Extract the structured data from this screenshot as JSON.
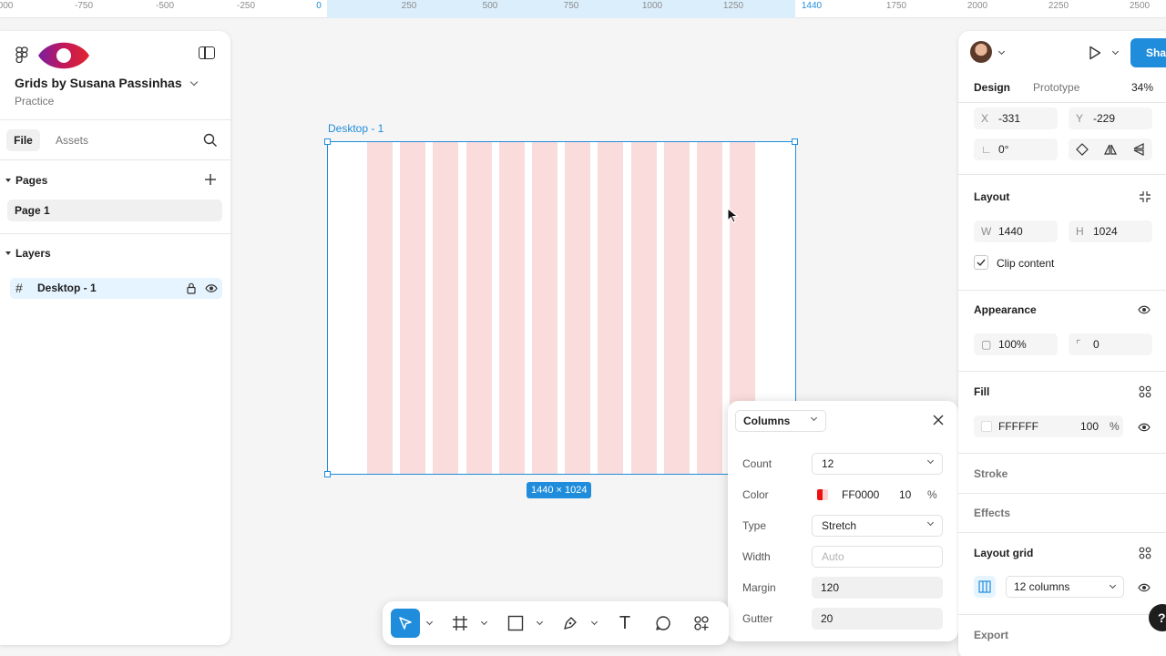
{
  "ruler": {
    "ticks": [
      "000",
      "-750",
      "-500",
      "-250",
      "0",
      "250",
      "500",
      "750",
      "1000",
      "1250",
      "1440",
      "1750",
      "2000",
      "2250",
      "2500"
    ]
  },
  "file": {
    "title": "Grids by Susana Passinhas",
    "project": "Practice",
    "tabs": {
      "file": "File",
      "assets": "Assets"
    }
  },
  "pages": {
    "heading": "Pages",
    "items": [
      "Page 1"
    ]
  },
  "layers": {
    "heading": "Layers",
    "items": [
      {
        "name": "Desktop - 1",
        "icon": "frame-hash-icon"
      }
    ]
  },
  "canvas": {
    "frame_label": "Desktop - 1",
    "size_label": "1440 × 1024",
    "column_count": 12,
    "grid_color": "#fbdcdc",
    "selection_color": "#1f8ddb"
  },
  "grid_popover": {
    "mode": "Columns",
    "count_label": "Count",
    "count": "12",
    "color_label": "Color",
    "color_hex": "FF0000",
    "color_opacity": "10",
    "percent": "%",
    "type_label": "Type",
    "type": "Stretch",
    "width_label": "Width",
    "width_placeholder": "Auto",
    "margin_label": "Margin",
    "margin": "120",
    "gutter_label": "Gutter",
    "gutter": "20"
  },
  "toolbar": {
    "tools": [
      "move-tool",
      "frame-tool",
      "shape-tool",
      "pen-tool",
      "text-tool",
      "comment-tool",
      "actions-tool"
    ],
    "text_glyph": "T"
  },
  "right_panel": {
    "share": "Share",
    "tabs": {
      "design": "Design",
      "prototype": "Prototype"
    },
    "zoom": "34%",
    "position": {
      "x_label": "X",
      "x": "-331",
      "y_label": "Y",
      "y": "-229"
    },
    "rotation": "0°",
    "layout": {
      "heading": "Layout",
      "w_label": "W",
      "w": "1440",
      "h_label": "H",
      "h": "1024",
      "clip_content": "Clip content"
    },
    "appearance": {
      "heading": "Appearance",
      "opacity": "100%",
      "radius": "0"
    },
    "fill": {
      "heading": "Fill",
      "hex": "FFFFFF",
      "opacity": "100",
      "percent": "%"
    },
    "stroke": "Stroke",
    "effects": "Effects",
    "layout_grid": {
      "heading": "Layout grid",
      "value": "12 columns"
    },
    "export": "Export"
  },
  "help": "?"
}
